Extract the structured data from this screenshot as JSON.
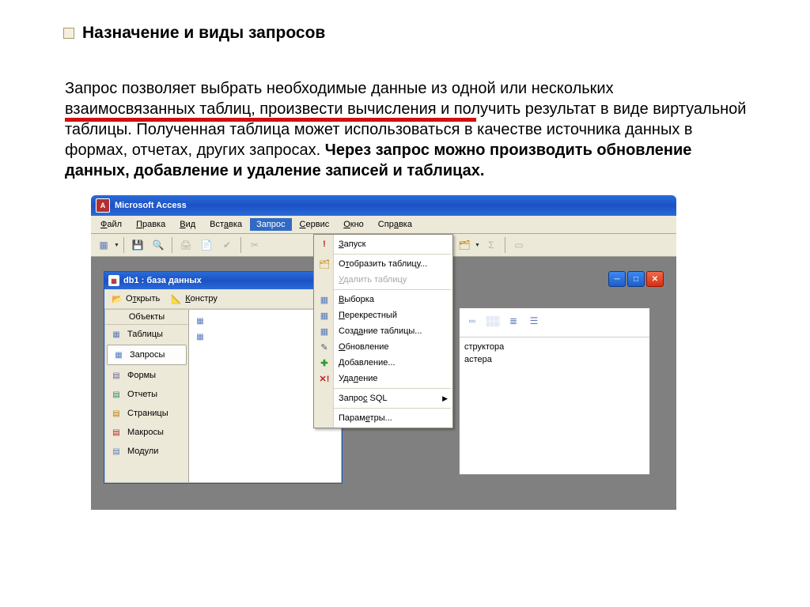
{
  "slide": {
    "title": "Назначение и виды запросов",
    "para1": "Запрос позволяет выбрать необходимые данные из одной или нескольких взаимосвязанных таблиц, произвести вычисления и получить результат в виде виртуальной таблицы. Полученная таблица может использоваться в качестве источника данных в формах, отчетах, других запросах. ",
    "para1_bold": "Через запрос можно производить обновление данных, добавление и удаление записей и таблицах."
  },
  "app": {
    "title": "Microsoft Access",
    "menu": {
      "file": "Файл",
      "edit": "Правка",
      "view": "Вид",
      "insert": "Вставка",
      "query": "Запрос",
      "service": "Сервис",
      "window": "Окно",
      "help": "Справка"
    }
  },
  "dropdown": {
    "run": "Запуск",
    "show_table": "Отобразить таблицу...",
    "delete_table": "Удалить таблицу",
    "select": "Выборка",
    "crosstab": "Перекрестный",
    "make_table": "Создание таблицы...",
    "update": "Обновление",
    "append": "Добавление...",
    "delete": "Удаление",
    "sql": "Запрос SQL",
    "params": "Параметры..."
  },
  "db": {
    "title": "db1 : база данных",
    "tb_open": "Открыть",
    "tb_design": "Констру",
    "sidebar_header": "Объекты",
    "sidebar": {
      "tables": "Таблицы",
      "queries": "Запросы",
      "forms": "Формы",
      "reports": "Отчеты",
      "pages": "Страницы",
      "macros": "Макросы",
      "modules": "Модули"
    },
    "list": {
      "item1": "структора",
      "item2": "астера"
    }
  },
  "icons": {
    "run": "!",
    "delete": "✕!",
    "grid": "▦",
    "pencil": "✎",
    "plus": "✚",
    "minus": "➖",
    "sigma": "Σ",
    "arrow": "▸",
    "key": "🔑"
  }
}
